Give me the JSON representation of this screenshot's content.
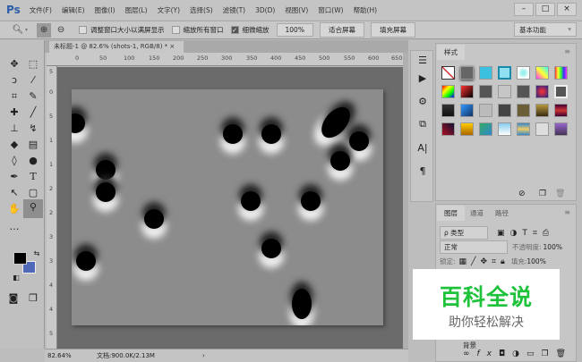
{
  "app": {
    "logo": "Ps"
  },
  "menu": [
    "文件(F)",
    "编辑(E)",
    "图像(I)",
    "图层(L)",
    "文字(Y)",
    "选择(S)",
    "滤镜(T)",
    "3D(D)",
    "视图(V)",
    "窗口(W)",
    "帮助(H)"
  ],
  "window_controls": {
    "minimize": "–",
    "maximize": "□",
    "close": "×"
  },
  "options": {
    "resize_windows": {
      "label": "调整窗口大小以满屏显示",
      "checked": false
    },
    "zoom_all": {
      "label": "缩放所有窗口",
      "checked": false
    },
    "scrubby_zoom": {
      "label": "细微缩放",
      "checked": true
    },
    "zoom_value": "100%",
    "fit_screen": "适合屏幕",
    "fill_screen": "填充屏幕",
    "workspace": "基本功能"
  },
  "document": {
    "tab_title": "未标题-1 @ 82.6% (shots-1, RGB/8) *",
    "close": "×"
  },
  "rulers": {
    "h": [
      "0",
      "50",
      "100",
      "150",
      "200",
      "250",
      "300",
      "350",
      "400",
      "450",
      "500",
      "550",
      "600",
      "650"
    ],
    "v": [
      "5",
      "0",
      "5",
      "1",
      "1",
      "2",
      "2",
      "3",
      "3",
      "4",
      "4",
      "5"
    ]
  },
  "status": {
    "zoom": "82.64%",
    "doc": "文档:900.0K/2.13M",
    "arrow": "›"
  },
  "colors": {
    "foreground": "#000000",
    "background": "#5068b8"
  },
  "styles_panel": {
    "title": "样式",
    "menu": "≡"
  },
  "layers_panel": {
    "tabs": [
      "图层",
      "通道",
      "路径"
    ],
    "filter": "ρ 类型",
    "blend_mode": "正常",
    "opacity_label": "不透明度:",
    "opacity": "100%",
    "lock_label": "锁定:",
    "fill_label": "填充:",
    "fill": "100%",
    "layer_name": "背景"
  },
  "watermark": {
    "title": "百科全说",
    "subtitle": "助你轻松解决"
  }
}
